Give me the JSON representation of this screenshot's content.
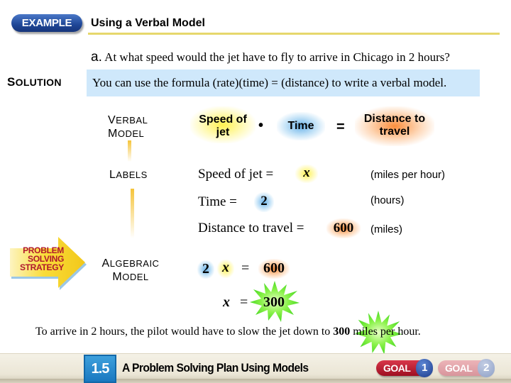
{
  "header": {
    "badge": "EXAMPLE",
    "title": "Using a Verbal Model"
  },
  "question": {
    "letter": "a.",
    "text": "At what speed would the jet have to fly to arrive in Chicago in 2 hours?"
  },
  "solution": {
    "label_cap": "S",
    "label_rest": "OLUTION",
    "text": "You can use the formula (rate)(time) = (distance) to write a verbal model."
  },
  "verbal_model": {
    "label_line1_cap": "V",
    "label_line1_rest": "ERBAL",
    "label_line2_cap": "M",
    "label_line2_rest": "ODEL",
    "term1_line1": "Speed of",
    "term1_line2": "jet",
    "times_op": "•",
    "term2": "Time",
    "equals_op": "=",
    "term3_line1": "Distance to",
    "term3_line2": "travel"
  },
  "labels": {
    "label_cap": "L",
    "label_rest": "ABELS",
    "rows": [
      {
        "name": "Speed of jet =",
        "value": "x",
        "unit": "(miles per hour)"
      },
      {
        "name": "Time =",
        "value": "2",
        "unit": "(hours)"
      },
      {
        "name": "Distance to travel =",
        "value": "600",
        "unit": "(miles)"
      }
    ]
  },
  "strategy_badge": {
    "line1": "PROBLEM",
    "line2": "SOLVING",
    "line3": "STRATEGY"
  },
  "algebraic_model": {
    "label_line1_cap": "A",
    "label_line1_rest": "LGEBRAIC",
    "label_line2_cap": "M",
    "label_line2_rest": "ODEL",
    "equation": {
      "coef": "2",
      "var": "x",
      "equals": "=",
      "rhs": "600"
    },
    "result": {
      "var": "x",
      "equals": "=",
      "value": "300"
    }
  },
  "conclusion": {
    "before": "To arrive in 2 hours, the pilot would have to slow the jet down to",
    "highlight": "300",
    "after": "miles per hour."
  },
  "footer": {
    "section_number": "1.5",
    "section_title": "A Problem Solving Plan Using Models",
    "goal1_label": "GOAL",
    "goal1_number": "1",
    "goal2_label": "GOAL",
    "goal2_number": "2"
  },
  "colors": {
    "example_badge": "#1e4696",
    "solution_box": "#cfe8fb",
    "header_rule": "#e6d76c",
    "highlight_yellow": "#fff03c",
    "highlight_blue": "#5aaae6",
    "highlight_orange": "#fa8228",
    "starburst_green": "#66ee33",
    "section_blue": "#2a8cd0",
    "goal_active": "#b01a2e",
    "goal_inactive": "#e0a4aa"
  }
}
